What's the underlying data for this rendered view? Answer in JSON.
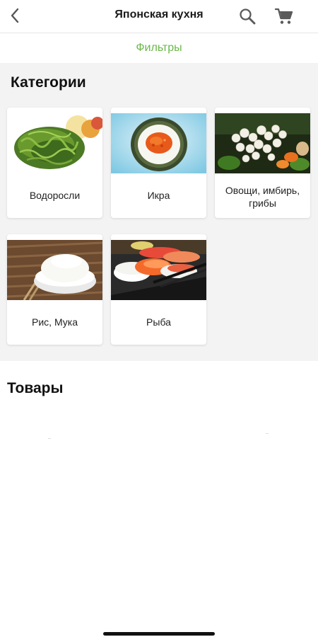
{
  "header": {
    "title": "Японская кухня",
    "icons": {
      "back": "chevron-left-icon",
      "search": "search-icon",
      "cart": "cart-icon"
    }
  },
  "filters": {
    "label": "Фильтры",
    "color": "#6bb84b"
  },
  "categories": {
    "title": "Категории",
    "items": [
      {
        "label": "Водоросли",
        "image": "seaweed-salad"
      },
      {
        "label": "Икра",
        "image": "caviar-rice-bowl"
      },
      {
        "label": "Овощи, имбирь, грибы",
        "image": "mushrooms-vegetables"
      },
      {
        "label": "Рис, Мука",
        "image": "rice-bowl-chopsticks"
      },
      {
        "label": "Рыба",
        "image": "sushi-plate"
      }
    ]
  },
  "products": {
    "title": "Товары"
  },
  "colors": {
    "section_background": "#f3f3f3",
    "accent": "#6bb84b"
  }
}
